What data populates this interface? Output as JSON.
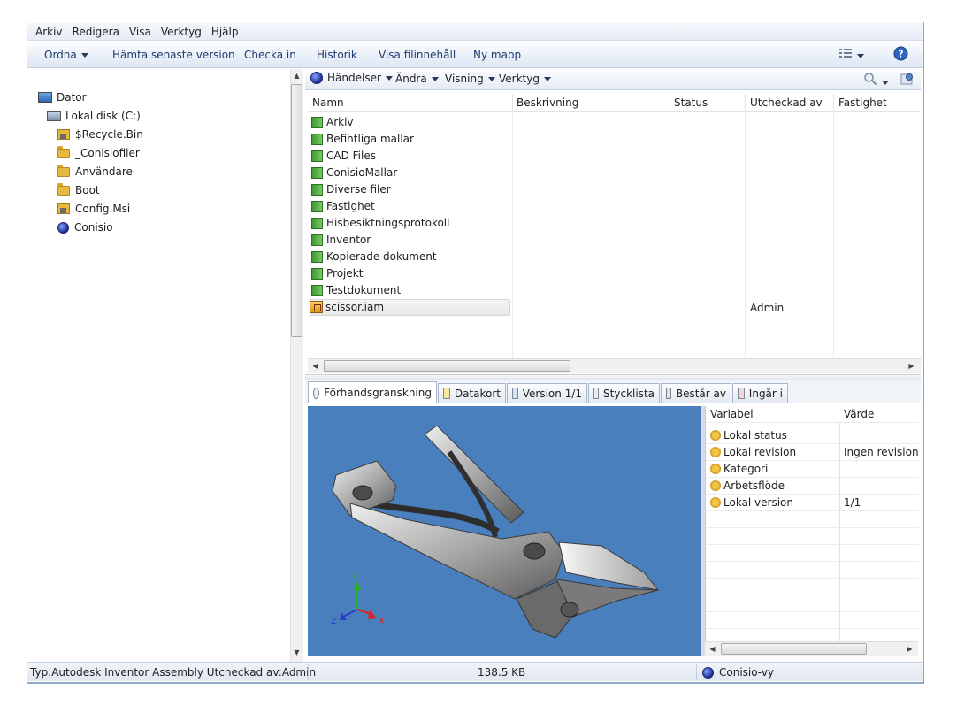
{
  "menu": [
    "Arkiv",
    "Redigera",
    "Visa",
    "Verktyg",
    "Hjälp"
  ],
  "toolbar": {
    "organize": "Ordna",
    "get_latest": "Hämta senaste version",
    "check_in": "Checka in",
    "history": "Historik",
    "show_content": "Visa filinnehåll",
    "new_folder": "Ny mapp"
  },
  "tree": {
    "root": "Dator",
    "drive": "Lokal disk (C:)",
    "items": [
      "$Recycle.Bin",
      "_Conisiofiler",
      "Användare",
      "Boot",
      "Config.Msi",
      "Conisio"
    ]
  },
  "subtoolbar": {
    "events": "Händelser",
    "change": "Ändra",
    "view": "Visning",
    "tools": "Verktyg"
  },
  "list": {
    "columns": [
      "Namn",
      "Beskrivning",
      "Status",
      "Utcheckad av",
      "Fastighet"
    ],
    "folders": [
      "Arkiv",
      "Befintliga mallar",
      "CAD Files",
      "ConisioMallar",
      "Diverse filer",
      "Fastighet",
      "Hisbesiktningsprotokoll",
      "Inventor",
      "Kopierade dokument",
      "Projekt",
      "Testdokument"
    ],
    "file": {
      "name": "scissor.iam",
      "checked_out_by": "Admin"
    }
  },
  "tabs": [
    "Förhandsgranskning",
    "Datakort",
    "Version 1/1",
    "Stycklista",
    "Består av",
    "Ingår i"
  ],
  "props": {
    "columns": [
      "Variabel",
      "Värde"
    ],
    "rows": [
      {
        "name": "Lokal status",
        "value": ""
      },
      {
        "name": "Lokal revision",
        "value": "Ingen revision"
      },
      {
        "name": "Kategori",
        "value": ""
      },
      {
        "name": "Arbetsflöde",
        "value": ""
      },
      {
        "name": "Lokal version",
        "value": "1/1"
      }
    ]
  },
  "axes": {
    "x": "X",
    "y": "Y",
    "z": "Z"
  },
  "status": {
    "info": "Typ:Autodesk Inventor Assembly  Utcheckad av:Admin",
    "size": "138.5 KB",
    "view": "Conisio-vy"
  },
  "colors": {
    "preview_bg": "#4a7fbe",
    "toolbar_text": "#1e3b6e"
  }
}
